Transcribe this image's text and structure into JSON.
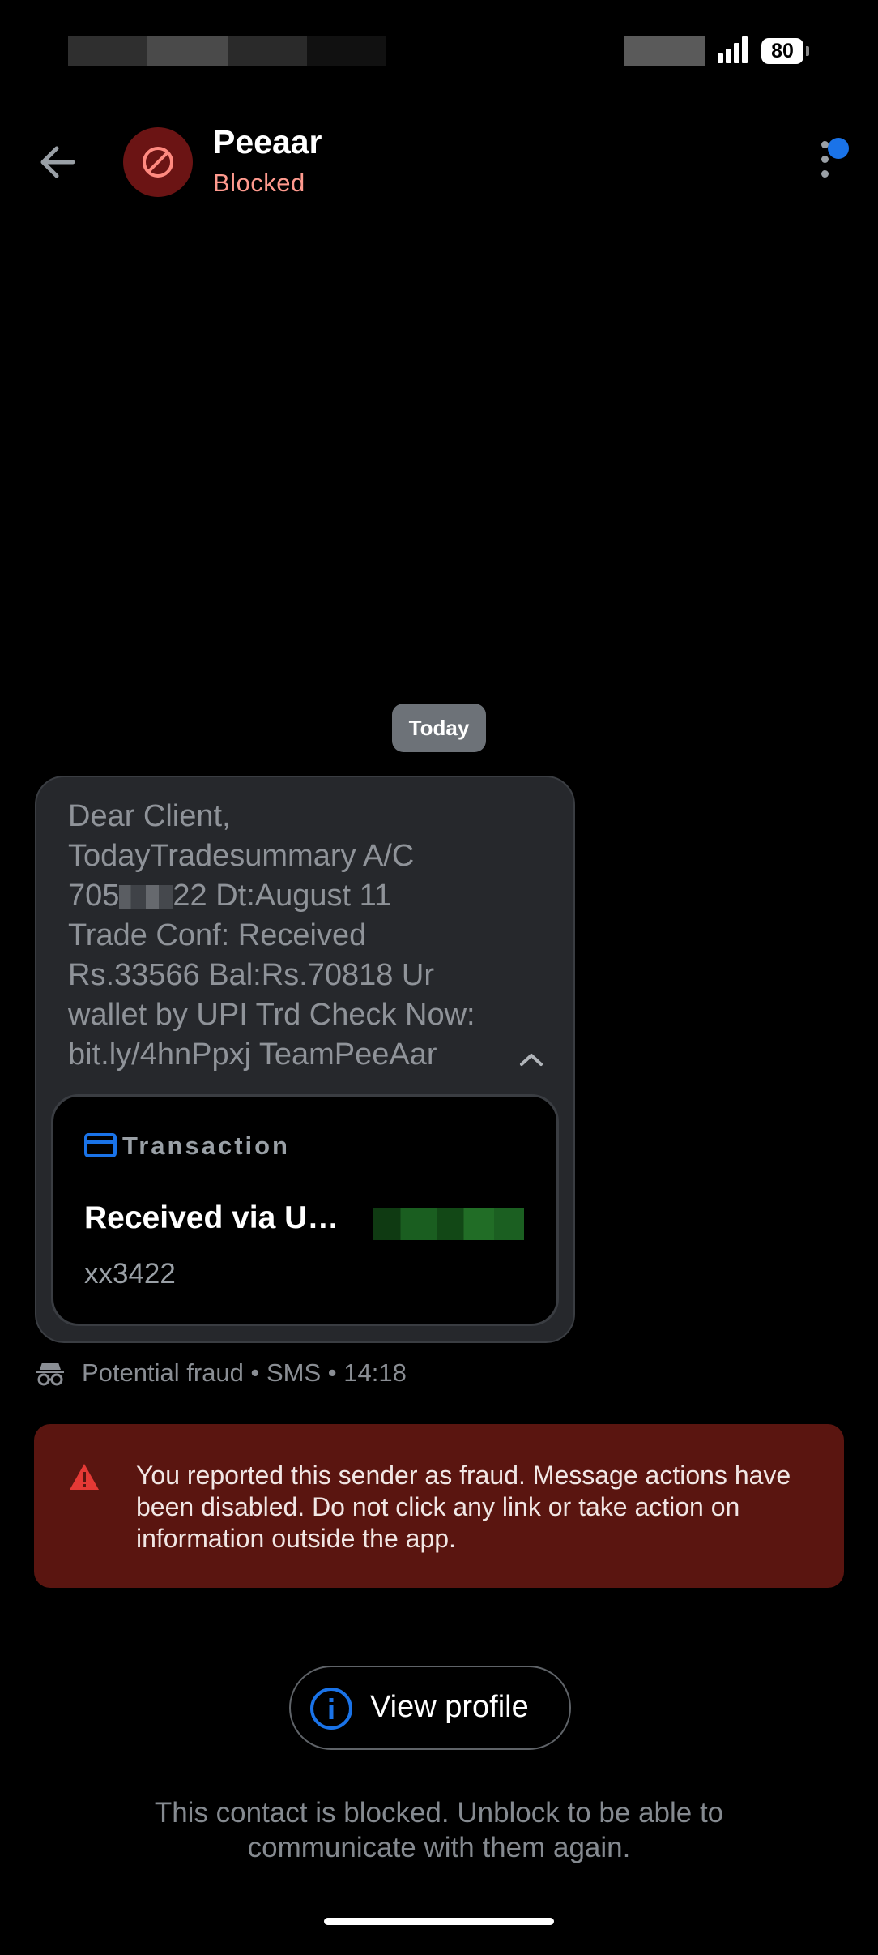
{
  "status_bar": {
    "battery": "80"
  },
  "header": {
    "contact_name": "Peeaar",
    "contact_status": "Blocked"
  },
  "conversation": {
    "date_label": "Today",
    "message": {
      "lines": [
        "Dear Client,",
        "TodayTradesummary A/C",
        "705",
        "22 Dt:August 11",
        "Trade Conf: Received",
        "Rs.33566 Bal:Rs.70818 Ur",
        "wallet by UPI Trd Check Now:",
        "bit.ly/4hnPpxj TeamPeeAar"
      ]
    },
    "transaction_card": {
      "label": "Transaction",
      "title": "Received via U…",
      "account": "xx3422"
    },
    "meta": "Potential fraud • SMS • 14:18"
  },
  "warning": {
    "text": "You reported this sender as fraud. Message actions have been disabled. Do not click any link or take action on information outside the app."
  },
  "view_profile": {
    "label": "View profile"
  },
  "blocked_note": {
    "text": "This contact is blocked. Unblock to be able to communicate with them again."
  },
  "colors": {
    "accent": "#1a73e8",
    "blocked_avatar": "#6b1414",
    "warning_bg": "#5a1510",
    "warning_icon": "#e53935",
    "status_text": "#ff9a8e"
  },
  "icons": {
    "back": "arrow-back-icon",
    "avatar": "blocked-icon",
    "menu": "more-vert-icon",
    "card": "credit-card-icon",
    "meta": "spy-icon",
    "warning": "warning-triangle-icon",
    "info": "info-icon"
  }
}
